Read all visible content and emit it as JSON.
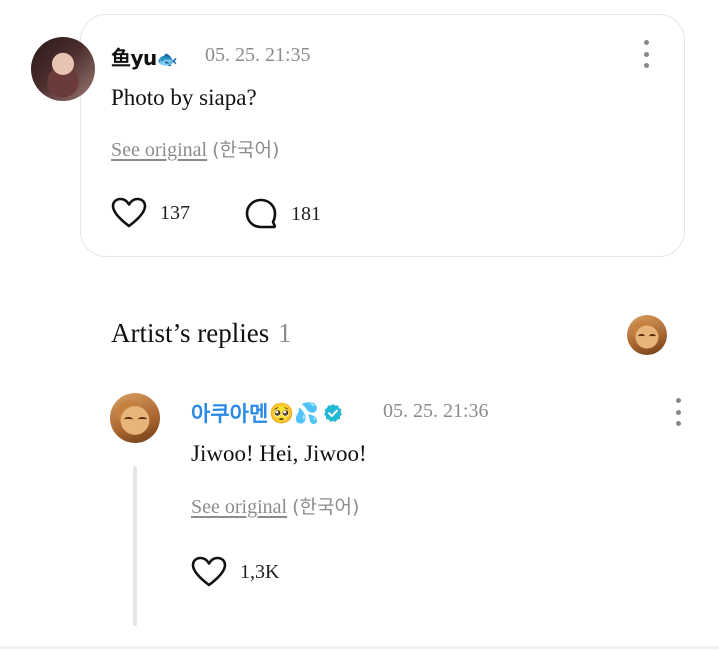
{
  "comment": {
    "username": "鱼yu",
    "username_emoji": "🐟",
    "date": "05. 25. 21:35",
    "text": "Photo by siapa?",
    "see_original": "See original",
    "language": "(한국어)",
    "like_count": "137",
    "reply_count": "181"
  },
  "artist_replies": {
    "title": "Artist’s replies",
    "count": "1"
  },
  "reply": {
    "username": "아쿠아멘",
    "username_emoji": "🥺💦",
    "verified": true,
    "date": "05. 25. 21:36",
    "text": "Jiwoo! Hei, Jiwoo!",
    "see_original": "See original",
    "language": "(한국어)",
    "like_count": "1,3K"
  },
  "colors": {
    "artist_name": "#2b8ae6",
    "verified_badge": "#21b8d4",
    "muted_text": "#8c8c8c"
  },
  "icons": [
    "more-vertical-icon",
    "heart-icon",
    "comment-bubble-icon",
    "verified-badge-icon"
  ]
}
